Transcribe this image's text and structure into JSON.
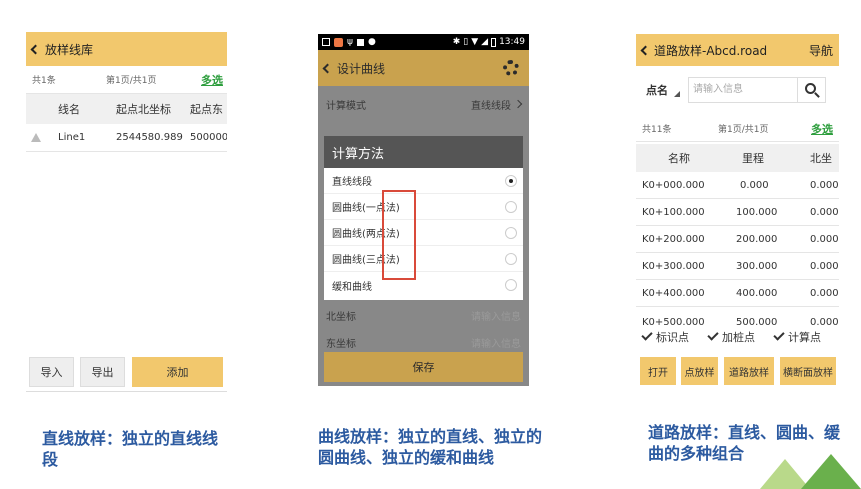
{
  "screen1": {
    "title": "放样线库",
    "count": "共1条",
    "pager": "第1页/共1页",
    "multi_select": "多选",
    "columns": [
      "线名",
      "起点北坐标",
      "起点东"
    ],
    "rows": [
      {
        "name": "Line1",
        "north": "2544580.989",
        "east": "500000"
      }
    ],
    "buttons": {
      "import": "导入",
      "export": "导出",
      "add": "添加"
    }
  },
  "screen2": {
    "status_time": "13:49",
    "title": "设计曲线",
    "mode_label": "计算模式",
    "mode_value": "直线线段",
    "dialog_title": "计算方法",
    "options": [
      "直线线段",
      "圆曲线(一点法)",
      "圆曲线(两点法)",
      "圆曲线(三点法)",
      "缓和曲线"
    ],
    "selected_option": "直线线段",
    "north_label": "北坐标",
    "north_placeholder": "请输入信息",
    "east_label": "东坐标",
    "east_placeholder": "请输入信息",
    "save": "保存"
  },
  "screen3": {
    "title": "道路放样-Abcd.road",
    "nav": "导航",
    "search_type": "点名",
    "search_placeholder": "请输入信息",
    "count": "共11条",
    "pager": "第1页/共1页",
    "multi_select": "多选",
    "columns": [
      "名称",
      "里程",
      "北坐"
    ],
    "rows": [
      {
        "name": "K0+000.000",
        "mileage": "0.000",
        "north": "0.000"
      },
      {
        "name": "K0+100.000",
        "mileage": "100.000",
        "north": "0.000"
      },
      {
        "name": "K0+200.000",
        "mileage": "200.000",
        "north": "0.000"
      },
      {
        "name": "K0+300.000",
        "mileage": "300.000",
        "north": "0.000"
      },
      {
        "name": "K0+400.000",
        "mileage": "400.000",
        "north": "0.000"
      },
      {
        "name": "K0+500.000",
        "mileage": "500.000",
        "north": "0.000"
      }
    ],
    "checkboxes": [
      "标识点",
      "加桩点",
      "计算点"
    ],
    "buttons": [
      "打开",
      "点放样",
      "道路放样",
      "横断面放样"
    ]
  },
  "captions": {
    "c1": "直线放样：独立的直线线段",
    "c2": "曲线放样：独立的直线、独立的圆曲线、独立的缓和曲线",
    "c3": "道路放样：直线、圆曲、缓曲的多种组合"
  },
  "colors": {
    "accent": "#f2c86d",
    "dim_accent": "#c9a24e",
    "caption": "#2c5aa0",
    "highlight": "#d94a3a",
    "link": "#2e9e3e"
  }
}
